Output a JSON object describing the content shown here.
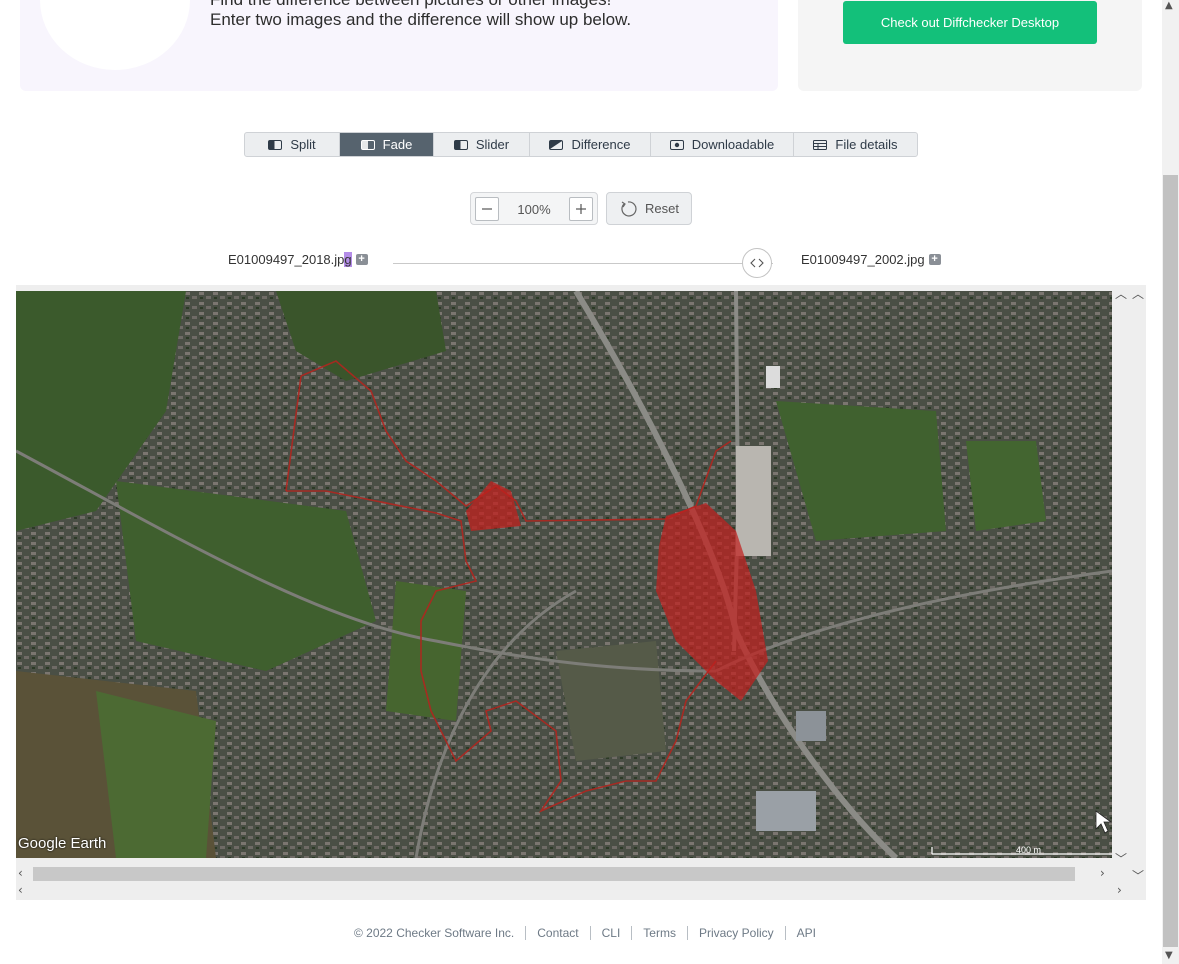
{
  "intro": {
    "line1": "Find the difference between pictures or other images!",
    "line2": "Enter two images and the difference will show up below."
  },
  "desktop_cta": {
    "label": "Check out Diffchecker Desktop"
  },
  "tabs": [
    {
      "label": "Split",
      "icon": "split-icon"
    },
    {
      "label": "Fade",
      "icon": "fade-icon",
      "active": true
    },
    {
      "label": "Slider",
      "icon": "slider-icon"
    },
    {
      "label": "Difference",
      "icon": "difference-icon"
    },
    {
      "label": "Downloadable",
      "icon": "downloadable-icon"
    },
    {
      "label": "File details",
      "icon": "file-details-icon"
    }
  ],
  "zoom": {
    "value": "100%",
    "reset_label": "Reset"
  },
  "files": {
    "left_prefix": "E01009497_2018.jp",
    "left_highlight": "g",
    "right": "E01009497_2002.jpg"
  },
  "fade": {
    "position": 1.0
  },
  "map": {
    "watermark": "Google Earth",
    "scale_label": "400 m"
  },
  "footer": {
    "copyright": "© 2022 Checker Software Inc.",
    "links": [
      "Contact",
      "CLI",
      "Terms",
      "Privacy Policy",
      "API"
    ]
  },
  "colors": {
    "accent_green": "#13c07a",
    "active_tab": "#56636e",
    "highlight_region": "#c0201e"
  }
}
